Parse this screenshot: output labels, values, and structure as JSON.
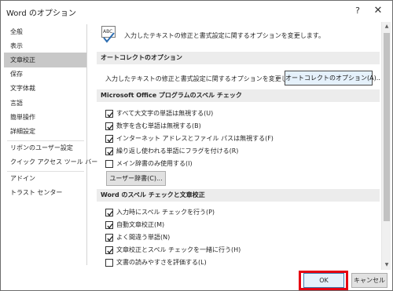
{
  "window": {
    "title": "Word のオプション",
    "help_label": "?",
    "close_label": "✕"
  },
  "sidebar": {
    "items": [
      {
        "label": "全般",
        "active": false
      },
      {
        "label": "表示",
        "active": false
      },
      {
        "label": "文章校正",
        "active": true
      },
      {
        "label": "保存",
        "active": false
      },
      {
        "label": "文字体裁",
        "active": false
      },
      {
        "label": "言語",
        "active": false
      },
      {
        "label": "簡単操作",
        "active": false
      },
      {
        "label": "詳細設定",
        "active": false
      },
      {
        "label": "リボンのユーザー設定",
        "active": false
      },
      {
        "label": "クイック アクセス ツール バー",
        "active": false
      },
      {
        "label": "アドイン",
        "active": false
      },
      {
        "label": "トラスト センター",
        "active": false
      }
    ]
  },
  "intro": {
    "icon": "abc-spellcheck-icon",
    "text": "入力したテキストの修正と書式設定に関するオプションを変更します。"
  },
  "autocorrect": {
    "header": "オートコレクトのオプション",
    "description": "入力したテキストの修正と書式設定に関するオプションを変更します。",
    "button": "オートコレクトのオプション(A)..."
  },
  "office_spelling": {
    "header": "Microsoft Office プログラムのスペル チェック",
    "options": [
      {
        "label": "すべて大文字の単語は無視する(U)",
        "checked": true
      },
      {
        "label": "数字を含む単語は無視する(B)",
        "checked": true
      },
      {
        "label": "インターネット アドレスとファイル パスは無視する(F)",
        "checked": true
      },
      {
        "label": "繰り返し使われる単語にフラグを付ける(R)",
        "checked": true
      },
      {
        "label": "メイン辞書のみ使用する(I)",
        "checked": false
      }
    ],
    "dict_button": "ユーザー辞書(C)..."
  },
  "word_spelling": {
    "header": "Word のスペル チェックと文章校正",
    "options": [
      {
        "label": "入力時にスペル チェックを行う(P)",
        "checked": true
      },
      {
        "label": "自動文章校正(M)",
        "checked": true
      },
      {
        "label": "よく間違う単語(N)",
        "checked": true
      },
      {
        "label": "文章校正とスペル チェックを一緒に行う(H)",
        "checked": true
      },
      {
        "label": "文書の読みやすさを評価する(L)",
        "checked": false
      }
    ]
  },
  "footer": {
    "ok": "OK",
    "cancel": "キャンセル",
    "highlight_color": "#e60012"
  },
  "colors": {
    "sidebar_active": "#c8c8c8",
    "section_header_bg": "#ececec",
    "button_focus_bg": "#e5f1fb"
  }
}
